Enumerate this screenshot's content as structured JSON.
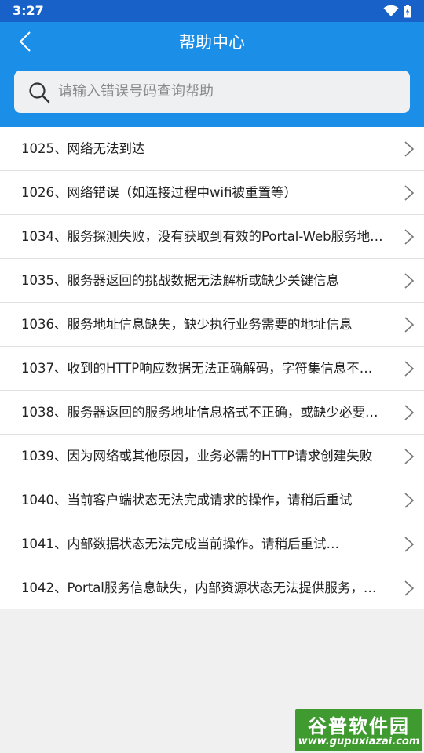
{
  "status_bar": {
    "time": "3:27",
    "wifi_icon": "wifi-icon",
    "battery_icon": "battery-icon"
  },
  "header": {
    "title": "帮助中心",
    "back_icon": "chevron-left-icon"
  },
  "search": {
    "placeholder": "请输入错误号码查询帮助",
    "icon": "search-icon"
  },
  "help_items": [
    {
      "label": "1025、网络无法到达"
    },
    {
      "label": "1026、网络错误（如连接过程中wifi被重置等）"
    },
    {
      "label": "1034、服务探测失败，没有获取到有效的Portal-Web服务地…"
    },
    {
      "label": "1035、服务器返回的挑战数据无法解析或缺少关键信息"
    },
    {
      "label": "1036、服务地址信息缺失，缺少执行业务需要的地址信息"
    },
    {
      "label": "1037、收到的HTTP响应数据无法正确解码，字符集信息不…"
    },
    {
      "label": "1038、服务器返回的服务地址信息格式不正确，或缺少必要…"
    },
    {
      "label": "1039、因为网络或其他原因，业务必需的HTTP请求创建失败"
    },
    {
      "label": "1040、当前客户端状态无法完成请求的操作，请稍后重试"
    },
    {
      "label": "1041、内部数据状态无法完成当前操作。请稍后重试…"
    },
    {
      "label": "1042、Portal服务信息缺失，内部资源状态无法提供服务，…"
    }
  ],
  "watermark": {
    "text_cn": "谷普软件园",
    "text_url": "www.gupuxiazai.com"
  },
  "colors": {
    "status_bar": "#1761c9",
    "app_bar": "#1b8ee8",
    "background": "#f0f0f0",
    "watermark": "#3f9a2f"
  }
}
